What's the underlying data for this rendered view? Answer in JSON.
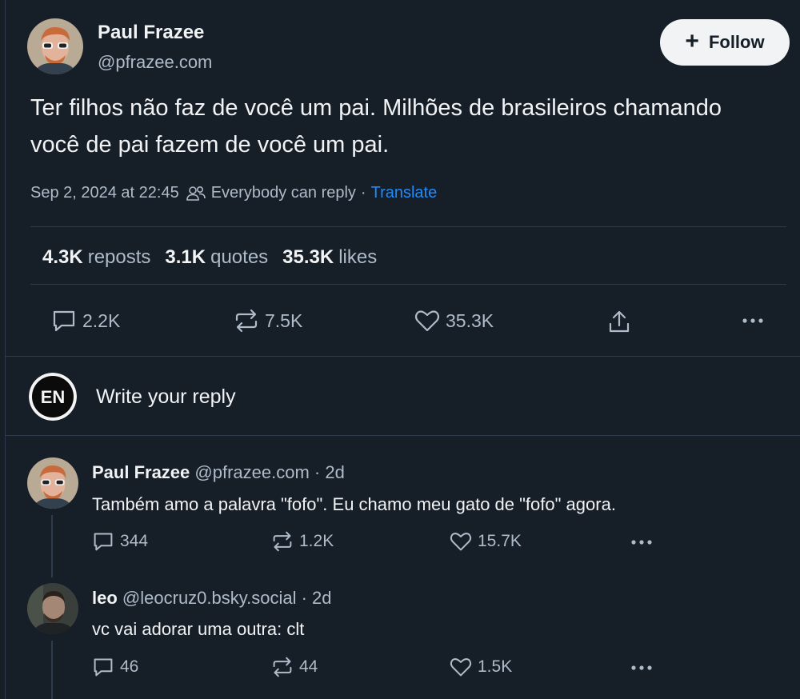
{
  "post": {
    "author_name": "Paul Frazee",
    "author_handle": "@pfrazee.com",
    "follow_label": "Follow",
    "text": "Ter filhos não faz de você um pai. Milhões de brasileiros chamando você de pai fazem de você um pai.",
    "timestamp": "Sep 2, 2024 at 22:45",
    "reply_setting": "Everybody can reply",
    "separator": "·",
    "translate_label": "Translate",
    "stats": {
      "reposts_count": "4.3K",
      "reposts_label": "reposts",
      "quotes_count": "3.1K",
      "quotes_label": "quotes",
      "likes_count": "35.3K",
      "likes_label": "likes"
    },
    "actions": {
      "replies": "2.2K",
      "reposts": "7.5K",
      "likes": "35.3K"
    }
  },
  "composer": {
    "avatar_text": "EN",
    "placeholder": "Write your reply"
  },
  "replies": [
    {
      "name": "Paul Frazee",
      "meta": "@pfrazee.com · 2d",
      "text": "Também amo a palavra \"fofo\". Eu chamo meu gato de \"fofo\" agora.",
      "replies": "344",
      "reposts": "1.2K",
      "likes": "15.7K"
    },
    {
      "name": "leo",
      "meta": "@leocruz0.bsky.social · 2d",
      "text": "vc vai adorar uma outra: clt",
      "replies": "46",
      "reposts": "44",
      "likes": "1.5K"
    }
  ],
  "colors": {
    "background": "#161e27",
    "text_primary": "#f1f3f5",
    "text_secondary": "#aebbc9",
    "link": "#208bfe",
    "divider": "#2e3b4a"
  },
  "icons": {
    "reply": "speech-bubble-icon",
    "repost": "repost-arrows-icon",
    "like": "heart-icon",
    "share": "share-upload-icon",
    "more": "more-dots-icon",
    "reply_setting": "people-icon",
    "follow": "plus-icon"
  }
}
